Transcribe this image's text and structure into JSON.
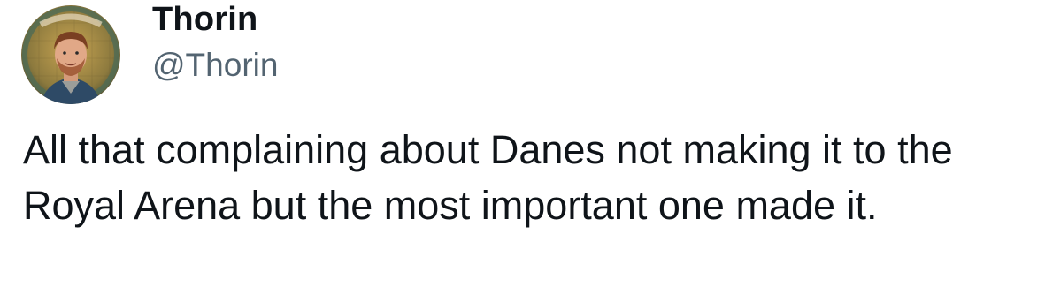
{
  "author": {
    "display_name": "Thorin",
    "handle": "@Thorin",
    "avatar_icon": "profile-photo-avatar"
  },
  "tweet": {
    "text": "All that complaining about Danes not making it to the Royal Arena but the most important one made it."
  },
  "colors": {
    "background": "#ffffff",
    "text_primary": "#0f1419",
    "text_secondary": "#536471"
  }
}
